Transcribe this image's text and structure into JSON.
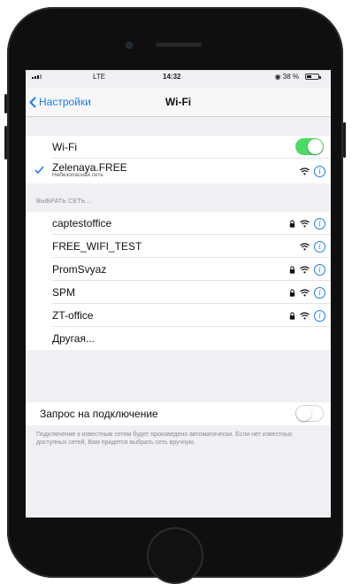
{
  "status_bar": {
    "carrier": "LTE",
    "time": "14:32",
    "battery": "◉ 38 %",
    "battery_level": 0.38
  },
  "nav": {
    "back_label": "Настройки",
    "title": "Wi-Fi"
  },
  "wifi": {
    "label": "Wi-Fi",
    "enabled": true,
    "connected_network": "Zelenaya.FREE",
    "connected_subtitle": "Небезопасная сеть"
  },
  "choose_network": {
    "header": "ВЫБРАТЬ СЕТЬ...",
    "networks": [
      {
        "name": "captestoffice",
        "locked": true
      },
      {
        "name": "FREE_WIFI_TEST",
        "locked": false
      },
      {
        "name": "PromSvyaz",
        "locked": true
      },
      {
        "name": "SPM",
        "locked": true
      },
      {
        "name": "ZT-office",
        "locked": true
      }
    ],
    "other_label": "Другая..."
  },
  "ask_to_join": {
    "label": "Запрос на подключение",
    "enabled": false,
    "footer": "Подключение к известным сетям будет произведено автоматически. Если нет известных доступных сетей, Вам придется выбрать сеть вручную."
  },
  "colors": {
    "accent": "#1a7cf5",
    "toggle_on": "#4cd964",
    "background": "#efeff4"
  },
  "icons": {
    "back": "chevron-left-icon",
    "checkmark": "checkmark-icon",
    "lock": "lock-icon",
    "wifi": "wifi-icon",
    "info": "info-icon"
  }
}
